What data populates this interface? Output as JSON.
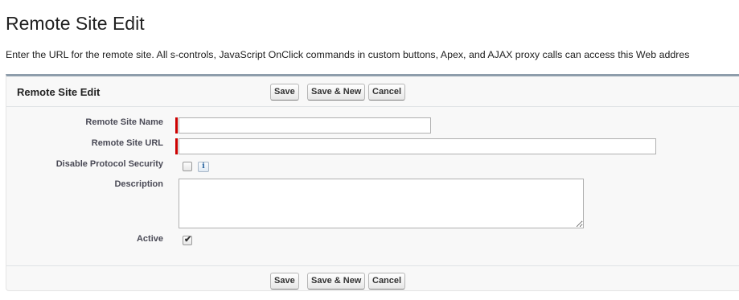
{
  "page": {
    "title": "Remote Site Edit",
    "description": "Enter the URL for the remote site. All s-controls, JavaScript OnClick commands in custom buttons, Apex, and AJAX proxy calls can access this Web addres"
  },
  "block": {
    "title": "Remote Site Edit",
    "buttons": {
      "save": "Save",
      "save_new": "Save & New",
      "cancel": "Cancel"
    }
  },
  "fields": {
    "remote_site_name": {
      "label": "Remote Site Name",
      "value": "",
      "required": true
    },
    "remote_site_url": {
      "label": "Remote Site URL",
      "value": "",
      "required": true
    },
    "disable_protocol_security": {
      "label": "Disable Protocol Security",
      "checked": false,
      "info_icon": "i"
    },
    "description": {
      "label": "Description",
      "value": ""
    },
    "active": {
      "label": "Active",
      "checked": true
    }
  },
  "colors": {
    "required_marker": "#cc0000",
    "block_top_border": "#8e9dab"
  }
}
